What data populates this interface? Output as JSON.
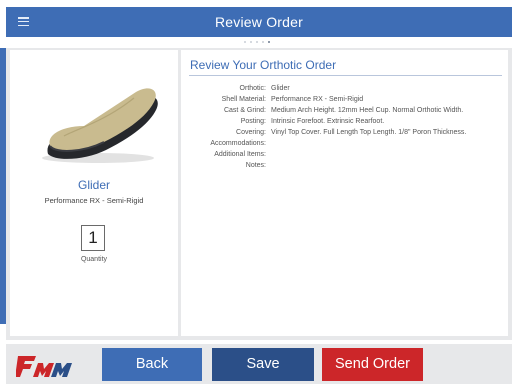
{
  "header": {
    "title": "Review Order",
    "menu_icon": "hamburger-menu-icon",
    "page_indicator": {
      "total": 5,
      "active": 5
    }
  },
  "product": {
    "name": "Glider",
    "material": "Performance RX - Semi-Rigid",
    "quantity": "1",
    "quantity_label": "Quantity",
    "image": "orthotic-insole-image"
  },
  "review": {
    "title": "Review Your Orthotic Order",
    "details": [
      {
        "label": "Orthotic:",
        "value": "Glider"
      },
      {
        "label": "Shell Material:",
        "value": "Performance RX - Semi-Rigid"
      },
      {
        "label": "Cast & Grind:",
        "value": "Medium Arch Height. 12mm Heel Cup. Normal Orthotic Width."
      },
      {
        "label": "Posting:",
        "value": "Intrinsic Forefoot. Extrinsic Rearfoot."
      },
      {
        "label": "Covering:",
        "value": "Vinyl Top Cover. Full Length Top Length. 1/8\" Poron Thickness."
      },
      {
        "label": "Accommodations:",
        "value": ""
      },
      {
        "label": "Additional Items:",
        "value": ""
      },
      {
        "label": "Notes:",
        "value": ""
      }
    ]
  },
  "footer": {
    "logo": "company-logo",
    "back_label": "Back",
    "save_label": "Save",
    "send_label": "Send Order"
  },
  "colors": {
    "primary_blue": "#3e6db5",
    "dark_blue": "#2b4f88",
    "send_red": "#cc2629",
    "panel_gray": "#e7e8ea"
  }
}
